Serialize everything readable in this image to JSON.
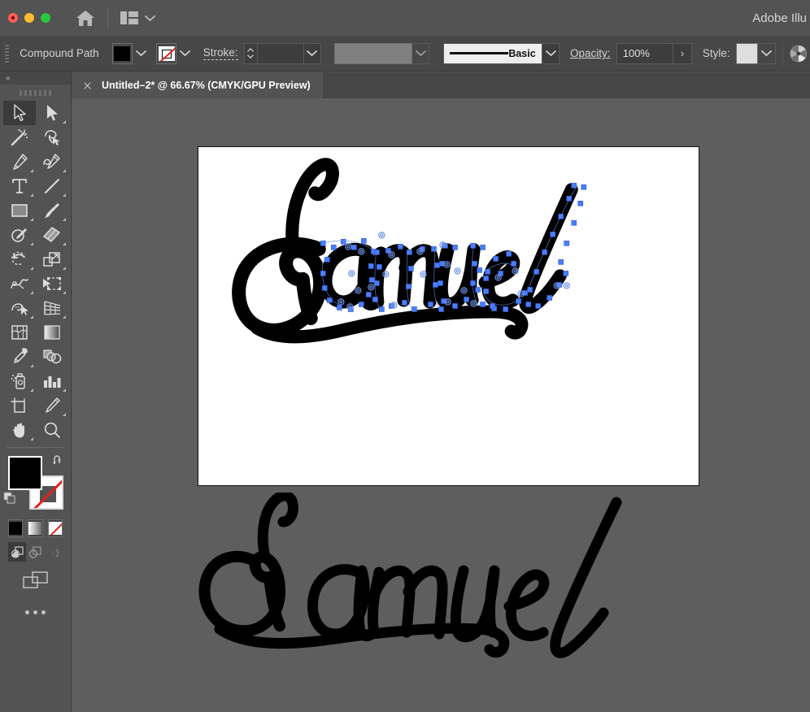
{
  "window": {
    "app_title": "Adobe Illu",
    "traffic_lights": [
      "close",
      "minimize",
      "maximize"
    ],
    "home_icon": "home-icon",
    "layout_icon": "layout-switcher-icon",
    "layout_caret": "chevron-down-icon"
  },
  "control_bar": {
    "object_type": "Compound Path",
    "fill_swatch": {
      "name": "fill-color-swatch",
      "color": "#000000"
    },
    "stroke_swatch": {
      "name": "stroke-color-swatch",
      "color": "none"
    },
    "stroke_label": "Stroke:",
    "stroke_weight_value": "",
    "stroke_weight_placeholder": "",
    "variable_width_value": "",
    "brush_definition": "Basic",
    "opacity_label": "Opacity:",
    "opacity_value": "100%",
    "opacity_expand": "›",
    "style_label": "Style:",
    "style_swatch_color": "#dedede",
    "pinwheel_icon": "color-wheel-icon"
  },
  "tab_bar": {
    "documents": [
      {
        "title": "Untitled–2* @ 66.67% (CMYK/GPU Preview)",
        "name": "Untitled-2",
        "modified": true,
        "zoom": "66.67%",
        "color_mode": "CMYK",
        "preview_mode": "GPU Preview",
        "active": true
      }
    ]
  },
  "tool_panel": {
    "collapse_label": "«",
    "tools": [
      {
        "name": "selection-tool",
        "label": "Selection",
        "active": true,
        "has_flyout": false
      },
      {
        "name": "direct-selection-tool",
        "label": "Direct Selection",
        "active": false,
        "has_flyout": true
      },
      {
        "name": "magic-wand-tool",
        "label": "Magic Wand",
        "active": false,
        "has_flyout": false
      },
      {
        "name": "lasso-tool",
        "label": "Lasso",
        "active": false,
        "has_flyout": false
      },
      {
        "name": "pen-tool",
        "label": "Pen",
        "active": false,
        "has_flyout": true
      },
      {
        "name": "curvature-tool",
        "label": "Curvature",
        "active": false,
        "has_flyout": true
      },
      {
        "name": "type-tool",
        "label": "Type",
        "active": false,
        "has_flyout": true
      },
      {
        "name": "line-segment-tool",
        "label": "Line Segment",
        "active": false,
        "has_flyout": true
      },
      {
        "name": "rectangle-tool",
        "label": "Rectangle",
        "active": false,
        "has_flyout": true
      },
      {
        "name": "paintbrush-tool",
        "label": "Paintbrush",
        "active": false,
        "has_flyout": true
      },
      {
        "name": "shaper-tool",
        "label": "Shaper",
        "active": false,
        "has_flyout": true
      },
      {
        "name": "eraser-tool",
        "label": "Eraser",
        "active": false,
        "has_flyout": true
      },
      {
        "name": "rotate-tool",
        "label": "Rotate",
        "active": false,
        "has_flyout": true
      },
      {
        "name": "scale-tool",
        "label": "Scale",
        "active": false,
        "has_flyout": true
      },
      {
        "name": "width-tool",
        "label": "Width",
        "active": false,
        "has_flyout": true
      },
      {
        "name": "free-transform-tool",
        "label": "Free Transform",
        "active": false,
        "has_flyout": true
      },
      {
        "name": "shape-builder-tool",
        "label": "Shape Builder",
        "active": false,
        "has_flyout": true
      },
      {
        "name": "perspective-grid-tool",
        "label": "Perspective Grid",
        "active": false,
        "has_flyout": true
      },
      {
        "name": "mesh-tool",
        "label": "Mesh",
        "active": false,
        "has_flyout": false
      },
      {
        "name": "gradient-tool",
        "label": "Gradient",
        "active": false,
        "has_flyout": false
      },
      {
        "name": "eyedropper-tool",
        "label": "Eyedropper",
        "active": false,
        "has_flyout": true
      },
      {
        "name": "blend-tool",
        "label": "Blend",
        "active": false,
        "has_flyout": false
      },
      {
        "name": "symbol-sprayer-tool",
        "label": "Symbol Sprayer",
        "active": false,
        "has_flyout": true
      },
      {
        "name": "column-graph-tool",
        "label": "Column Graph",
        "active": false,
        "has_flyout": true
      },
      {
        "name": "artboard-tool",
        "label": "Artboard",
        "active": false,
        "has_flyout": false
      },
      {
        "name": "slice-tool",
        "label": "Slice",
        "active": false,
        "has_flyout": true
      },
      {
        "name": "hand-tool",
        "label": "Hand",
        "active": false,
        "has_flyout": true
      },
      {
        "name": "zoom-tool",
        "label": "Zoom",
        "active": false,
        "has_flyout": false
      }
    ],
    "fill_color": "#000000",
    "stroke_color": "none",
    "swap_icon": "swap-fill-stroke-icon",
    "default_icon": "default-fill-stroke-icon",
    "color_modes": [
      {
        "name": "color-mode-color",
        "label": "Color"
      },
      {
        "name": "color-mode-gradient",
        "label": "Gradient"
      },
      {
        "name": "color-mode-none",
        "label": "None"
      }
    ],
    "draw_modes": [
      {
        "name": "draw-normal-mode",
        "label": "Draw Normal",
        "active": true
      },
      {
        "name": "draw-behind-mode",
        "label": "Draw Behind",
        "active": false
      },
      {
        "name": "draw-inside-mode",
        "label": "Draw Inside",
        "active": false
      }
    ],
    "screen_mode": {
      "name": "change-screen-mode",
      "label": "Change Screen Mode"
    },
    "edit_toolbar": {
      "name": "edit-toolbar-button",
      "label": "Edit Toolbar"
    }
  },
  "canvas": {
    "background_color": "#5e5e5e",
    "artboard_color": "#ffffff",
    "artwork_text": "Samuel",
    "artwork_color": "#000000",
    "selection_color": "#4a7dfb",
    "selected_object": "Compound Path",
    "anchor_points_visible": true
  }
}
